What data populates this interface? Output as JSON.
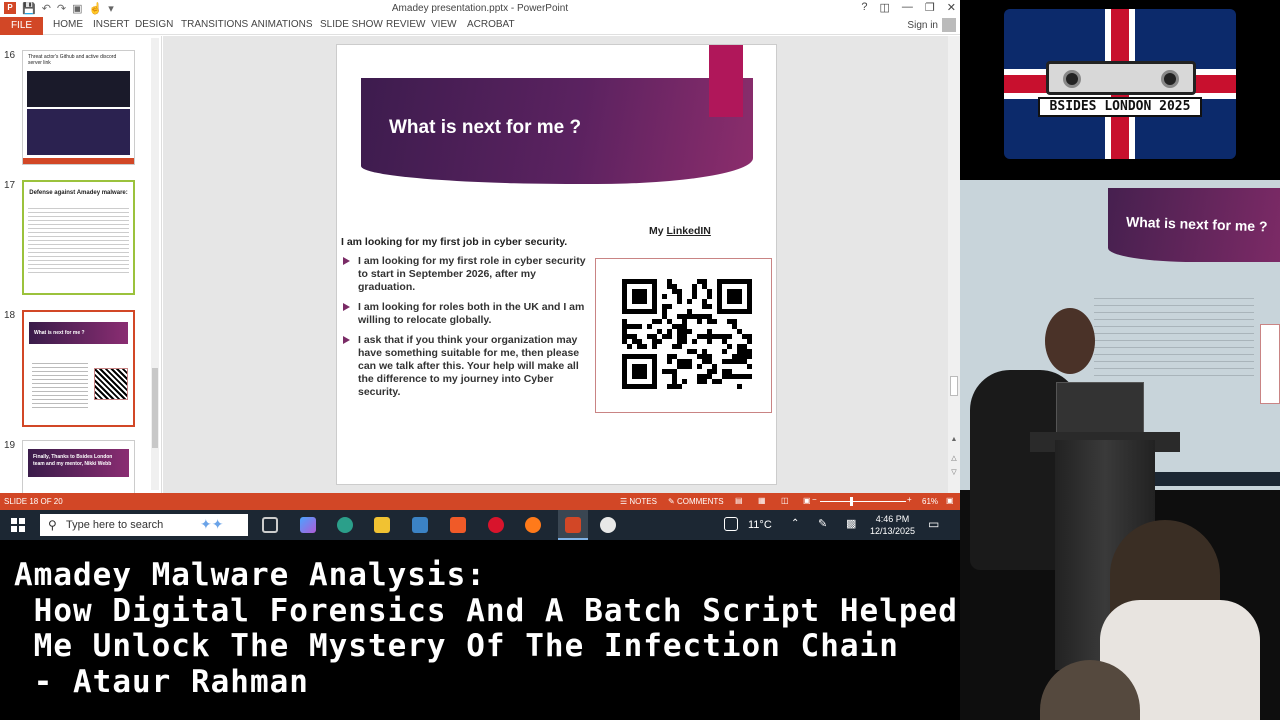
{
  "window": {
    "title": "Amadey presentation.pptx - PowerPoint",
    "help": "?",
    "sign_in": "Sign in"
  },
  "ribbon": {
    "tabs": [
      "FILE",
      "HOME",
      "INSERT",
      "DESIGN",
      "TRANSITIONS",
      "ANIMATIONS",
      "SLIDE SHOW",
      "REVIEW",
      "VIEW",
      "ACROBAT"
    ]
  },
  "thumbnails": [
    {
      "number": "16",
      "title": "Threat actor's Github and active discord server link"
    },
    {
      "number": "17",
      "title": "Defense against Amadey malware:"
    },
    {
      "number": "18",
      "title": "What is next for me ?"
    },
    {
      "number": "19",
      "title": "Finally, Thanks to Bsides London team and my mentor, Nikki Webb"
    }
  ],
  "slide": {
    "title": "What is next for me ?",
    "lead": "I am looking for my first job in cyber security.",
    "bullets": [
      "I am looking for my first role in cyber security to start in September 2026, after my graduation.",
      "I am looking for roles both in the UK and I am willing to relocate globally.",
      "I ask that if you think your organization may have something suitable for me, then please can we talk after this. Your help will make all the difference to my journey into Cyber security."
    ],
    "linkedin_prefix": "My",
    "linkedin_link": "LinkedIN"
  },
  "status": {
    "slide_info": "SLIDE 18 OF 20",
    "notes": "NOTES",
    "comments": "COMMENTS",
    "zoom": "61%"
  },
  "taskbar": {
    "search_placeholder": "Type here to search",
    "temperature": "11°C",
    "time": "4:46 PM",
    "date": "12/13/2025"
  },
  "caption": {
    "lines": [
      "Amadey Malware Analysis:",
      " How Digital Forensics And A Batch Script Helped",
      " Me Unlock The Mystery Of The Infection Chain",
      " - Ataur Rahman"
    ]
  },
  "video": {
    "logo_text": "BSIDES LONDON 2025",
    "screen_title": "What is next for me ?"
  },
  "colors": {
    "ppt_accent": "#d24726",
    "slide_purple": "#5b2260",
    "slide_magenta": "#b0175a"
  }
}
